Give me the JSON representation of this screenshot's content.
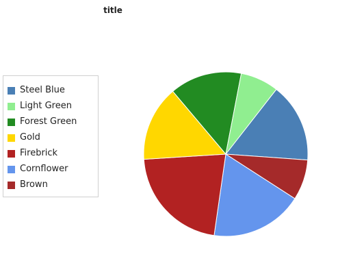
{
  "chart_data": {
    "type": "pie",
    "title": "title",
    "legend_position": "left",
    "slices": [
      {
        "label": "Steel Blue",
        "value": 14.5,
        "color": "#4a7fb5"
      },
      {
        "label": "Light Green",
        "value": 7.0,
        "color": "#90ee90"
      },
      {
        "label": "Forest Green",
        "value": 13.2,
        "color": "#228b22"
      },
      {
        "label": "Gold",
        "value": 13.8,
        "color": "#ffd700"
      },
      {
        "label": "Firebrick",
        "value": 20.2,
        "color": "#b22222"
      },
      {
        "label": "Cornflower",
        "value": 16.9,
        "color": "#6495ed"
      },
      {
        "label": "Brown",
        "value": 7.4,
        "color": "#a52a2a"
      }
    ]
  }
}
